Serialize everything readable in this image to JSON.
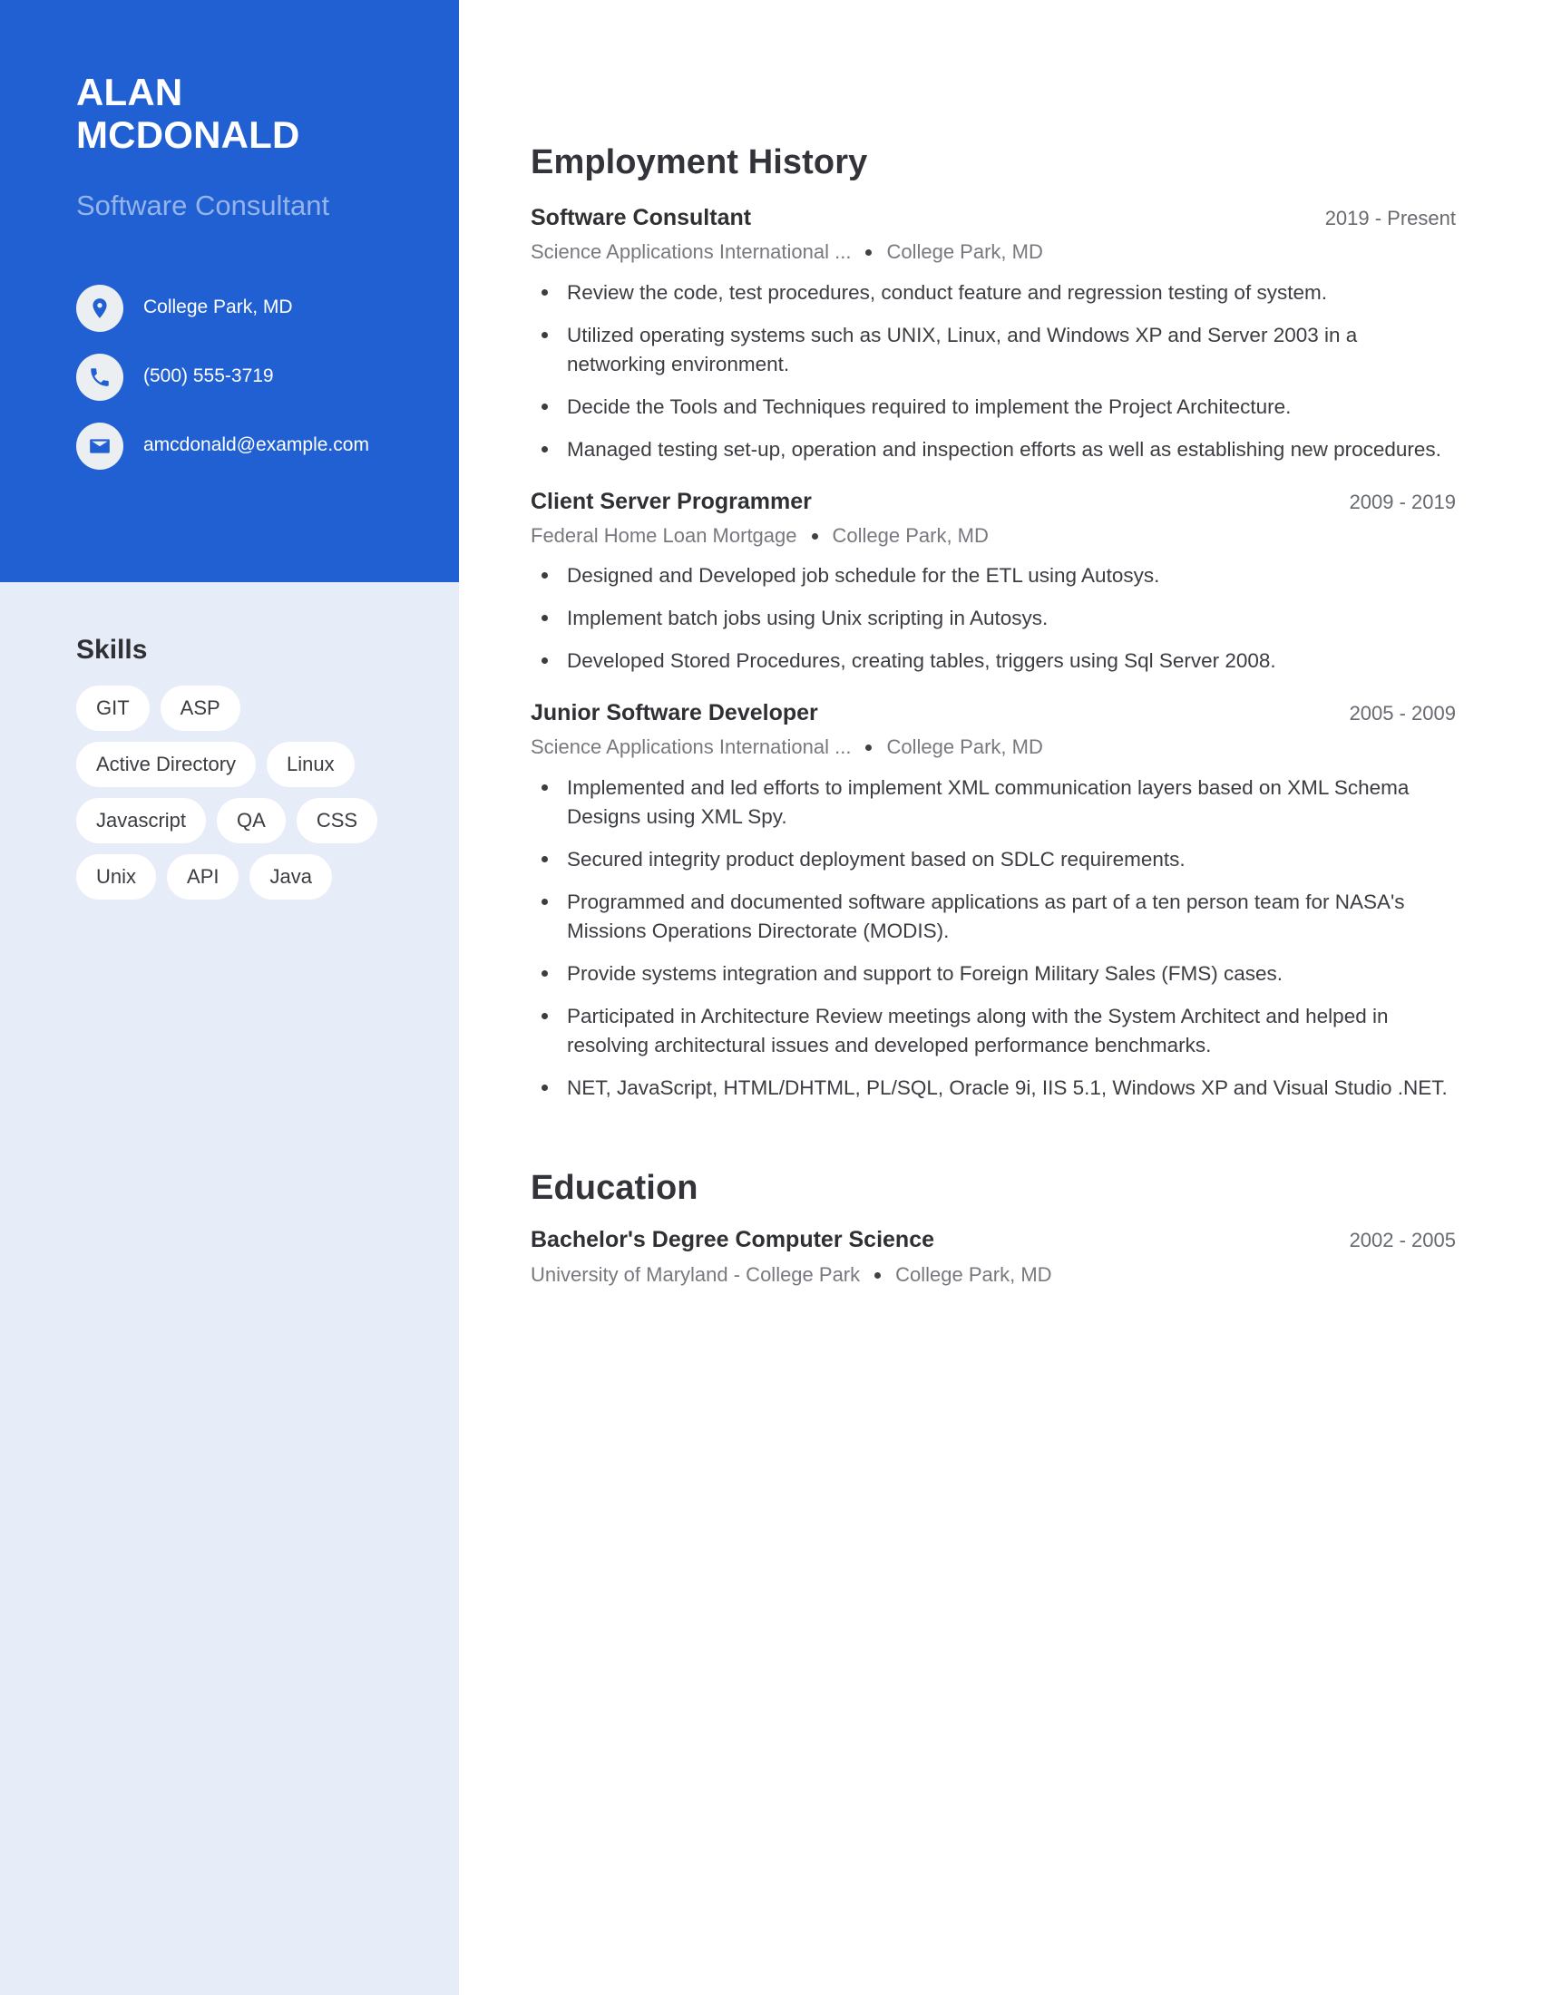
{
  "profile": {
    "first_name": "ALAN",
    "last_name": "MCDONALD",
    "headline": "Software Consultant"
  },
  "contacts": [
    {
      "icon": "location-pin-icon",
      "value": "College Park, MD"
    },
    {
      "icon": "phone-icon",
      "value": "(500) 555-3719"
    },
    {
      "icon": "email-icon",
      "value": "amcdonald@example.com"
    }
  ],
  "skills": {
    "title": "Skills",
    "items": [
      "GIT",
      "ASP",
      "Active Directory",
      "Linux",
      "Javascript",
      "QA",
      "CSS",
      "Unix",
      "API",
      "Java"
    ]
  },
  "employment": {
    "title": "Employment History",
    "entries": [
      {
        "role": "Software Consultant",
        "dates": "2019 - Present",
        "company": "Science Applications International ...",
        "location": "College Park, MD",
        "bullets": [
          "Review the code, test procedures, conduct feature and regression testing of system.",
          "Utilized operating systems such as UNIX, Linux, and Windows XP and Server 2003 in a networking environment.",
          "Decide the Tools and Techniques required to implement the Project Architecture.",
          "Managed testing set-up, operation and inspection efforts as well as establishing new procedures."
        ]
      },
      {
        "role": "Client Server Programmer",
        "dates": "2009 - 2019",
        "company": "Federal Home Loan Mortgage",
        "location": "College Park, MD",
        "bullets": [
          "Designed and Developed job schedule for the ETL using Autosys.",
          "Implement batch jobs using Unix scripting in Autosys.",
          "Developed Stored Procedures, creating tables, triggers using Sql Server 2008."
        ]
      },
      {
        "role": "Junior Software Developer",
        "dates": "2005 - 2009",
        "company": "Science Applications International ...",
        "location": "College Park, MD",
        "bullets": [
          "Implemented and led efforts to implement XML communication layers based on XML Schema Designs using XML Spy.",
          "Secured integrity product deployment based on SDLC requirements.",
          "Programmed and documented software applications as part of a ten person team for NASA's Missions Operations Directorate (MODIS).",
          "Provide systems integration and support to Foreign Military Sales (FMS) cases.",
          "Participated in Architecture Review meetings along with the System Architect and helped in resolving architectural issues and developed performance benchmarks.",
          "NET, JavaScript, HTML/DHTML, PL/SQL, Oracle 9i, IIS 5.1, Windows XP and Visual Studio .NET."
        ]
      }
    ]
  },
  "education": {
    "title": "Education",
    "entries": [
      {
        "degree": "Bachelor's Degree Computer Science",
        "dates": "2002 - 2005",
        "school": "University of Maryland - College Park",
        "location": "College Park, MD"
      }
    ]
  },
  "colors": {
    "sidebar_header": "#2160d3",
    "sidebar_body": "#e6ecf8",
    "headline": "#94b4ea",
    "pill_bg": "#ffffff"
  }
}
